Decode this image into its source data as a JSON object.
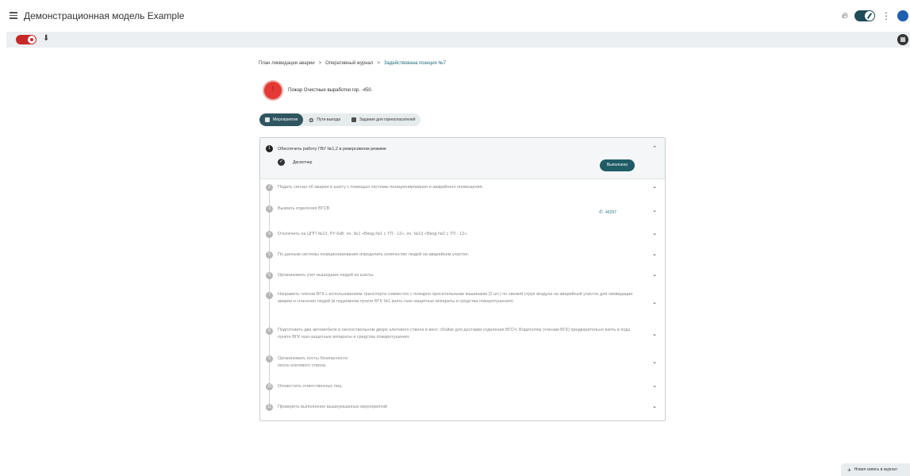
{
  "header": {
    "title": "Демонстрационная модель Example",
    "kebab": "⋮"
  },
  "toolbar": {
    "download_icon": "⬇",
    "doc_icon": "▦"
  },
  "breadcrumb": {
    "items": [
      "План ликвидации аварии",
      "Оперативный журнал",
      "Задействована позиция №7"
    ],
    "separator": ">"
  },
  "incident": {
    "title": "Пожар Очистные выработки гор. -450.",
    "color": "#e53935"
  },
  "tabs": [
    {
      "label": "Мероприятия",
      "icon": "checkbox-icon",
      "active": true
    },
    {
      "label": "Пути выхода",
      "icon": "walk-icon",
      "active": false
    },
    {
      "label": "Задания для горноспасателей",
      "icon": "doc-icon",
      "active": false
    }
  ],
  "steps": {
    "expanded": {
      "number": "1",
      "title": "Обеспечить работу ГВУ №1,2 в реверсивном режиме",
      "role": "Диспетчер",
      "done_label": "Выполнено"
    },
    "items": [
      {
        "number": "2",
        "text": "Подать сигнал об аварии в шахту с помощью системы позиционирования и аварийного оповещения."
      },
      {
        "number": "3",
        "text": "Вызвать отделения ВГСВ",
        "phone": "46297"
      },
      {
        "number": "4",
        "text": "Отключить на ЦПП №13, РУ-6кВ: яч. №1 «Ввод №1 с ТП - 12», яч. №13 «Ввод №2 с ТП - 12»."
      },
      {
        "number": "5",
        "text": "По данным системы позиционирования определить количество людей на аварийном участке."
      },
      {
        "number": "6",
        "text": "Организовать учет вышедших людей из шахты."
      },
      {
        "number": "7",
        "text": "Направить членов ВГК с использованием транспорта совместно с пожарно-оросительными машинами (2 шт.) по свежей струе воздуха на аварийный участок для ликвидации аварии и спасения людей (в подземном пункте ВГК №1 взять газо-защитные аппараты и средства пожаротушения)."
      },
      {
        "number": "8",
        "text": "Подготовить два автомобиля в околоствольном дворе клетевого ствола в вент. сбойке для доставки отделения ВГСЧ. Водителям (членам ВГК) предварительно взять в подз. пункте ВГК газо-защитные аппараты и средства пожаротушения."
      },
      {
        "number": "9",
        "text": "Организовать посты безопасности\nоколо клетевого ствола."
      },
      {
        "number": "10",
        "text": "Оповестить ответственных лиц."
      },
      {
        "number": "11",
        "text": "Проверить выполнение вышеуказанных мероприятий"
      }
    ]
  },
  "fab": {
    "label": "Новая запись в журнал"
  },
  "colors": {
    "accent": "#1f5c66",
    "record": "#c62828",
    "avatar": "#1f5fae"
  }
}
